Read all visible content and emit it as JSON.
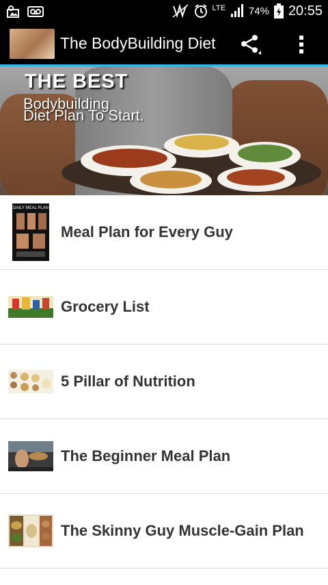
{
  "status_bar": {
    "battery_percent": "74%",
    "time": "20:55",
    "network": "LTE",
    "icons": [
      "gallery-icon",
      "voicemail-icon",
      "nfc-icon",
      "alarm-icon",
      "signal-icon",
      "battery-icon"
    ]
  },
  "action_bar": {
    "title": "The BodyBuilding Diet",
    "share_icon": "share-icon",
    "overflow_icon": "overflow-menu-icon"
  },
  "banner": {
    "line1": "THE BEST",
    "line2": "Bodybuilding",
    "line3": "Diet Plan To Start."
  },
  "menu": {
    "items": [
      {
        "label": "Meal Plan for Every Guy",
        "thumb_text": "DAILY MEAL PLAN"
      },
      {
        "label": "Grocery List"
      },
      {
        "label": "5 Pillar of Nutrition"
      },
      {
        "label": "The Beginner Meal Plan"
      },
      {
        "label": "The Skinny Guy Muscle-Gain Plan"
      }
    ]
  }
}
